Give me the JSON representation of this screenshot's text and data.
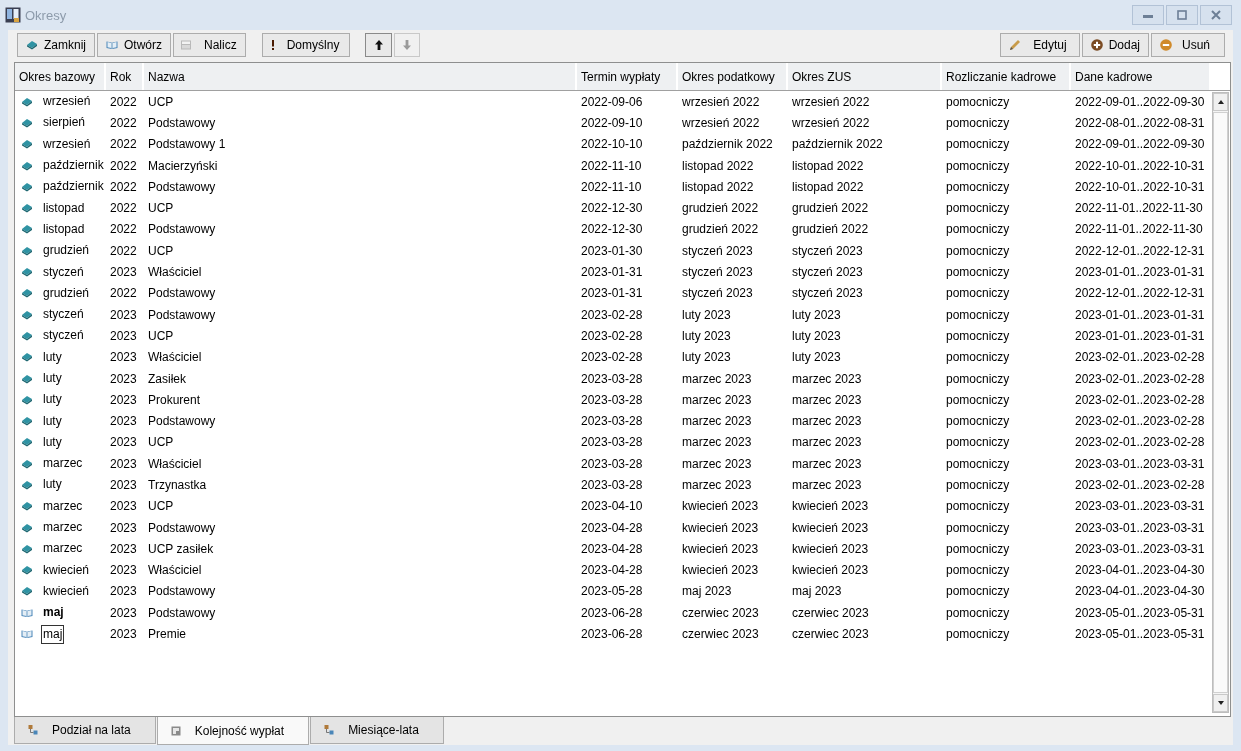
{
  "window": {
    "title": "Okresy"
  },
  "toolbar": {
    "left": [
      {
        "kind": "close",
        "label": "Zamknij",
        "disabled": false
      },
      {
        "kind": "open",
        "label": "Otwórz",
        "disabled": false
      },
      {
        "kind": "calculate",
        "label": "Nalicz",
        "disabled": false
      },
      {
        "kind": "default",
        "label": "Domyślny",
        "disabled": false
      },
      {
        "kind": "up",
        "disabled": false
      },
      {
        "kind": "down",
        "disabled": true
      }
    ],
    "right": [
      {
        "kind": "edit",
        "label": "Edytuj",
        "disabled": false
      },
      {
        "kind": "add",
        "label": "Dodaj",
        "disabled": false
      },
      {
        "kind": "remove",
        "label": "Usuń",
        "disabled": false
      }
    ]
  },
  "table": {
    "columns": [
      "Okres bazowy",
      "Rok",
      "Nazwa",
      "Termin wypłaty",
      "Okres podatkowy",
      "Okres ZUS",
      "Rozliczanie kadrowe",
      "Dane kadrowe"
    ],
    "rows": [
      {
        "kind": "closed",
        "current": false,
        "focused": false,
        "cells": [
          "wrzesień",
          "2022",
          "UCP",
          "2022-09-06",
          "wrzesień 2022",
          "wrzesień 2022",
          "pomocniczy",
          "2022-09-01..2022-09-30"
        ]
      },
      {
        "kind": "closed",
        "current": false,
        "focused": false,
        "cells": [
          "sierpień",
          "2022",
          "Podstawowy",
          "2022-09-10",
          "wrzesień 2022",
          "wrzesień 2022",
          "pomocniczy",
          "2022-08-01..2022-08-31"
        ]
      },
      {
        "kind": "closed",
        "current": false,
        "focused": false,
        "cells": [
          "wrzesień",
          "2022",
          "Podstawowy 1",
          "2022-10-10",
          "październik 2022",
          "październik 2022",
          "pomocniczy",
          "2022-09-01..2022-09-30"
        ]
      },
      {
        "kind": "closed",
        "current": false,
        "focused": false,
        "cells": [
          "październik",
          "2022",
          "Macierzyński",
          "2022-11-10",
          "listopad 2022",
          "listopad 2022",
          "pomocniczy",
          "2022-10-01..2022-10-31"
        ]
      },
      {
        "kind": "closed",
        "current": false,
        "focused": false,
        "cells": [
          "październik",
          "2022",
          "Podstawowy",
          "2022-11-10",
          "listopad 2022",
          "listopad 2022",
          "pomocniczy",
          "2022-10-01..2022-10-31"
        ]
      },
      {
        "kind": "closed",
        "current": false,
        "focused": false,
        "cells": [
          "listopad",
          "2022",
          "UCP",
          "2022-12-30",
          "grudzień 2022",
          "grudzień 2022",
          "pomocniczy",
          "2022-11-01..2022-11-30"
        ]
      },
      {
        "kind": "closed",
        "current": false,
        "focused": false,
        "cells": [
          "listopad",
          "2022",
          "Podstawowy",
          "2022-12-30",
          "grudzień 2022",
          "grudzień 2022",
          "pomocniczy",
          "2022-11-01..2022-11-30"
        ]
      },
      {
        "kind": "closed",
        "current": false,
        "focused": false,
        "cells": [
          "grudzień",
          "2022",
          "UCP",
          "2023-01-30",
          "styczeń 2023",
          "styczeń 2023",
          "pomocniczy",
          "2022-12-01..2022-12-31"
        ]
      },
      {
        "kind": "closed",
        "current": false,
        "focused": false,
        "cells": [
          "styczeń",
          "2023",
          "Właściciel",
          "2023-01-31",
          "styczeń 2023",
          "styczeń 2023",
          "pomocniczy",
          "2023-01-01..2023-01-31"
        ]
      },
      {
        "kind": "closed",
        "current": false,
        "focused": false,
        "cells": [
          "grudzień",
          "2022",
          "Podstawowy",
          "2023-01-31",
          "styczeń 2023",
          "styczeń 2023",
          "pomocniczy",
          "2022-12-01..2022-12-31"
        ]
      },
      {
        "kind": "closed",
        "current": false,
        "focused": false,
        "cells": [
          "styczeń",
          "2023",
          "Podstawowy",
          "2023-02-28",
          "luty 2023",
          "luty 2023",
          "pomocniczy",
          "2023-01-01..2023-01-31"
        ]
      },
      {
        "kind": "closed",
        "current": false,
        "focused": false,
        "cells": [
          "styczeń",
          "2023",
          "UCP",
          "2023-02-28",
          "luty 2023",
          "luty 2023",
          "pomocniczy",
          "2023-01-01..2023-01-31"
        ]
      },
      {
        "kind": "closed",
        "current": false,
        "focused": false,
        "cells": [
          "luty",
          "2023",
          "Właściciel",
          "2023-02-28",
          "luty 2023",
          "luty 2023",
          "pomocniczy",
          "2023-02-01..2023-02-28"
        ]
      },
      {
        "kind": "closed",
        "current": false,
        "focused": false,
        "cells": [
          "luty",
          "2023",
          "Zasiłek",
          "2023-03-28",
          "marzec 2023",
          "marzec 2023",
          "pomocniczy",
          "2023-02-01..2023-02-28"
        ]
      },
      {
        "kind": "closed",
        "current": false,
        "focused": false,
        "cells": [
          "luty",
          "2023",
          "Prokurent",
          "2023-03-28",
          "marzec 2023",
          "marzec 2023",
          "pomocniczy",
          "2023-02-01..2023-02-28"
        ]
      },
      {
        "kind": "closed",
        "current": false,
        "focused": false,
        "cells": [
          "luty",
          "2023",
          "Podstawowy",
          "2023-03-28",
          "marzec 2023",
          "marzec 2023",
          "pomocniczy",
          "2023-02-01..2023-02-28"
        ]
      },
      {
        "kind": "closed",
        "current": false,
        "focused": false,
        "cells": [
          "luty",
          "2023",
          "UCP",
          "2023-03-28",
          "marzec 2023",
          "marzec 2023",
          "pomocniczy",
          "2023-02-01..2023-02-28"
        ]
      },
      {
        "kind": "closed",
        "current": false,
        "focused": false,
        "cells": [
          "marzec",
          "2023",
          "Właściciel",
          "2023-03-28",
          "marzec 2023",
          "marzec 2023",
          "pomocniczy",
          "2023-03-01..2023-03-31"
        ]
      },
      {
        "kind": "closed",
        "current": false,
        "focused": false,
        "cells": [
          "luty",
          "2023",
          "Trzynastka",
          "2023-03-28",
          "marzec 2023",
          "marzec 2023",
          "pomocniczy",
          "2023-02-01..2023-02-28"
        ]
      },
      {
        "kind": "closed",
        "current": false,
        "focused": false,
        "cells": [
          "marzec",
          "2023",
          "UCP",
          "2023-04-10",
          "kwiecień 2023",
          "kwiecień 2023",
          "pomocniczy",
          "2023-03-01..2023-03-31"
        ]
      },
      {
        "kind": "closed",
        "current": false,
        "focused": false,
        "cells": [
          "marzec",
          "2023",
          "Podstawowy",
          "2023-04-28",
          "kwiecień 2023",
          "kwiecień 2023",
          "pomocniczy",
          "2023-03-01..2023-03-31"
        ]
      },
      {
        "kind": "closed",
        "current": false,
        "focused": false,
        "cells": [
          "marzec",
          "2023",
          "UCP zasiłek",
          "2023-04-28",
          "kwiecień 2023",
          "kwiecień 2023",
          "pomocniczy",
          "2023-03-01..2023-03-31"
        ]
      },
      {
        "kind": "closed",
        "current": false,
        "focused": false,
        "cells": [
          "kwiecień",
          "2023",
          "Właściciel",
          "2023-04-28",
          "kwiecień 2023",
          "kwiecień 2023",
          "pomocniczy",
          "2023-04-01..2023-04-30"
        ]
      },
      {
        "kind": "closed",
        "current": false,
        "focused": false,
        "cells": [
          "kwiecień",
          "2023",
          "Podstawowy",
          "2023-05-28",
          "maj 2023",
          "maj 2023",
          "pomocniczy",
          "2023-04-01..2023-04-30"
        ]
      },
      {
        "kind": "open",
        "current": true,
        "focused": false,
        "cells": [
          "maj",
          "2023",
          "Podstawowy",
          "2023-06-28",
          "czerwiec 2023",
          "czerwiec 2023",
          "pomocniczy",
          "2023-05-01..2023-05-31"
        ]
      },
      {
        "kind": "open",
        "current": false,
        "focused": true,
        "cells": [
          "maj",
          "2023",
          "Premie",
          "2023-06-28",
          "czerwiec 2023",
          "czerwiec 2023",
          "pomocniczy",
          "2023-05-01..2023-05-31"
        ]
      }
    ]
  },
  "tabs": [
    {
      "kind": "tree",
      "label": "Podział na lata",
      "selected": false
    },
    {
      "kind": "list",
      "label": "Kolejność wypłat",
      "selected": true
    },
    {
      "kind": "tree",
      "label": "Miesiące-lata",
      "selected": false
    }
  ]
}
